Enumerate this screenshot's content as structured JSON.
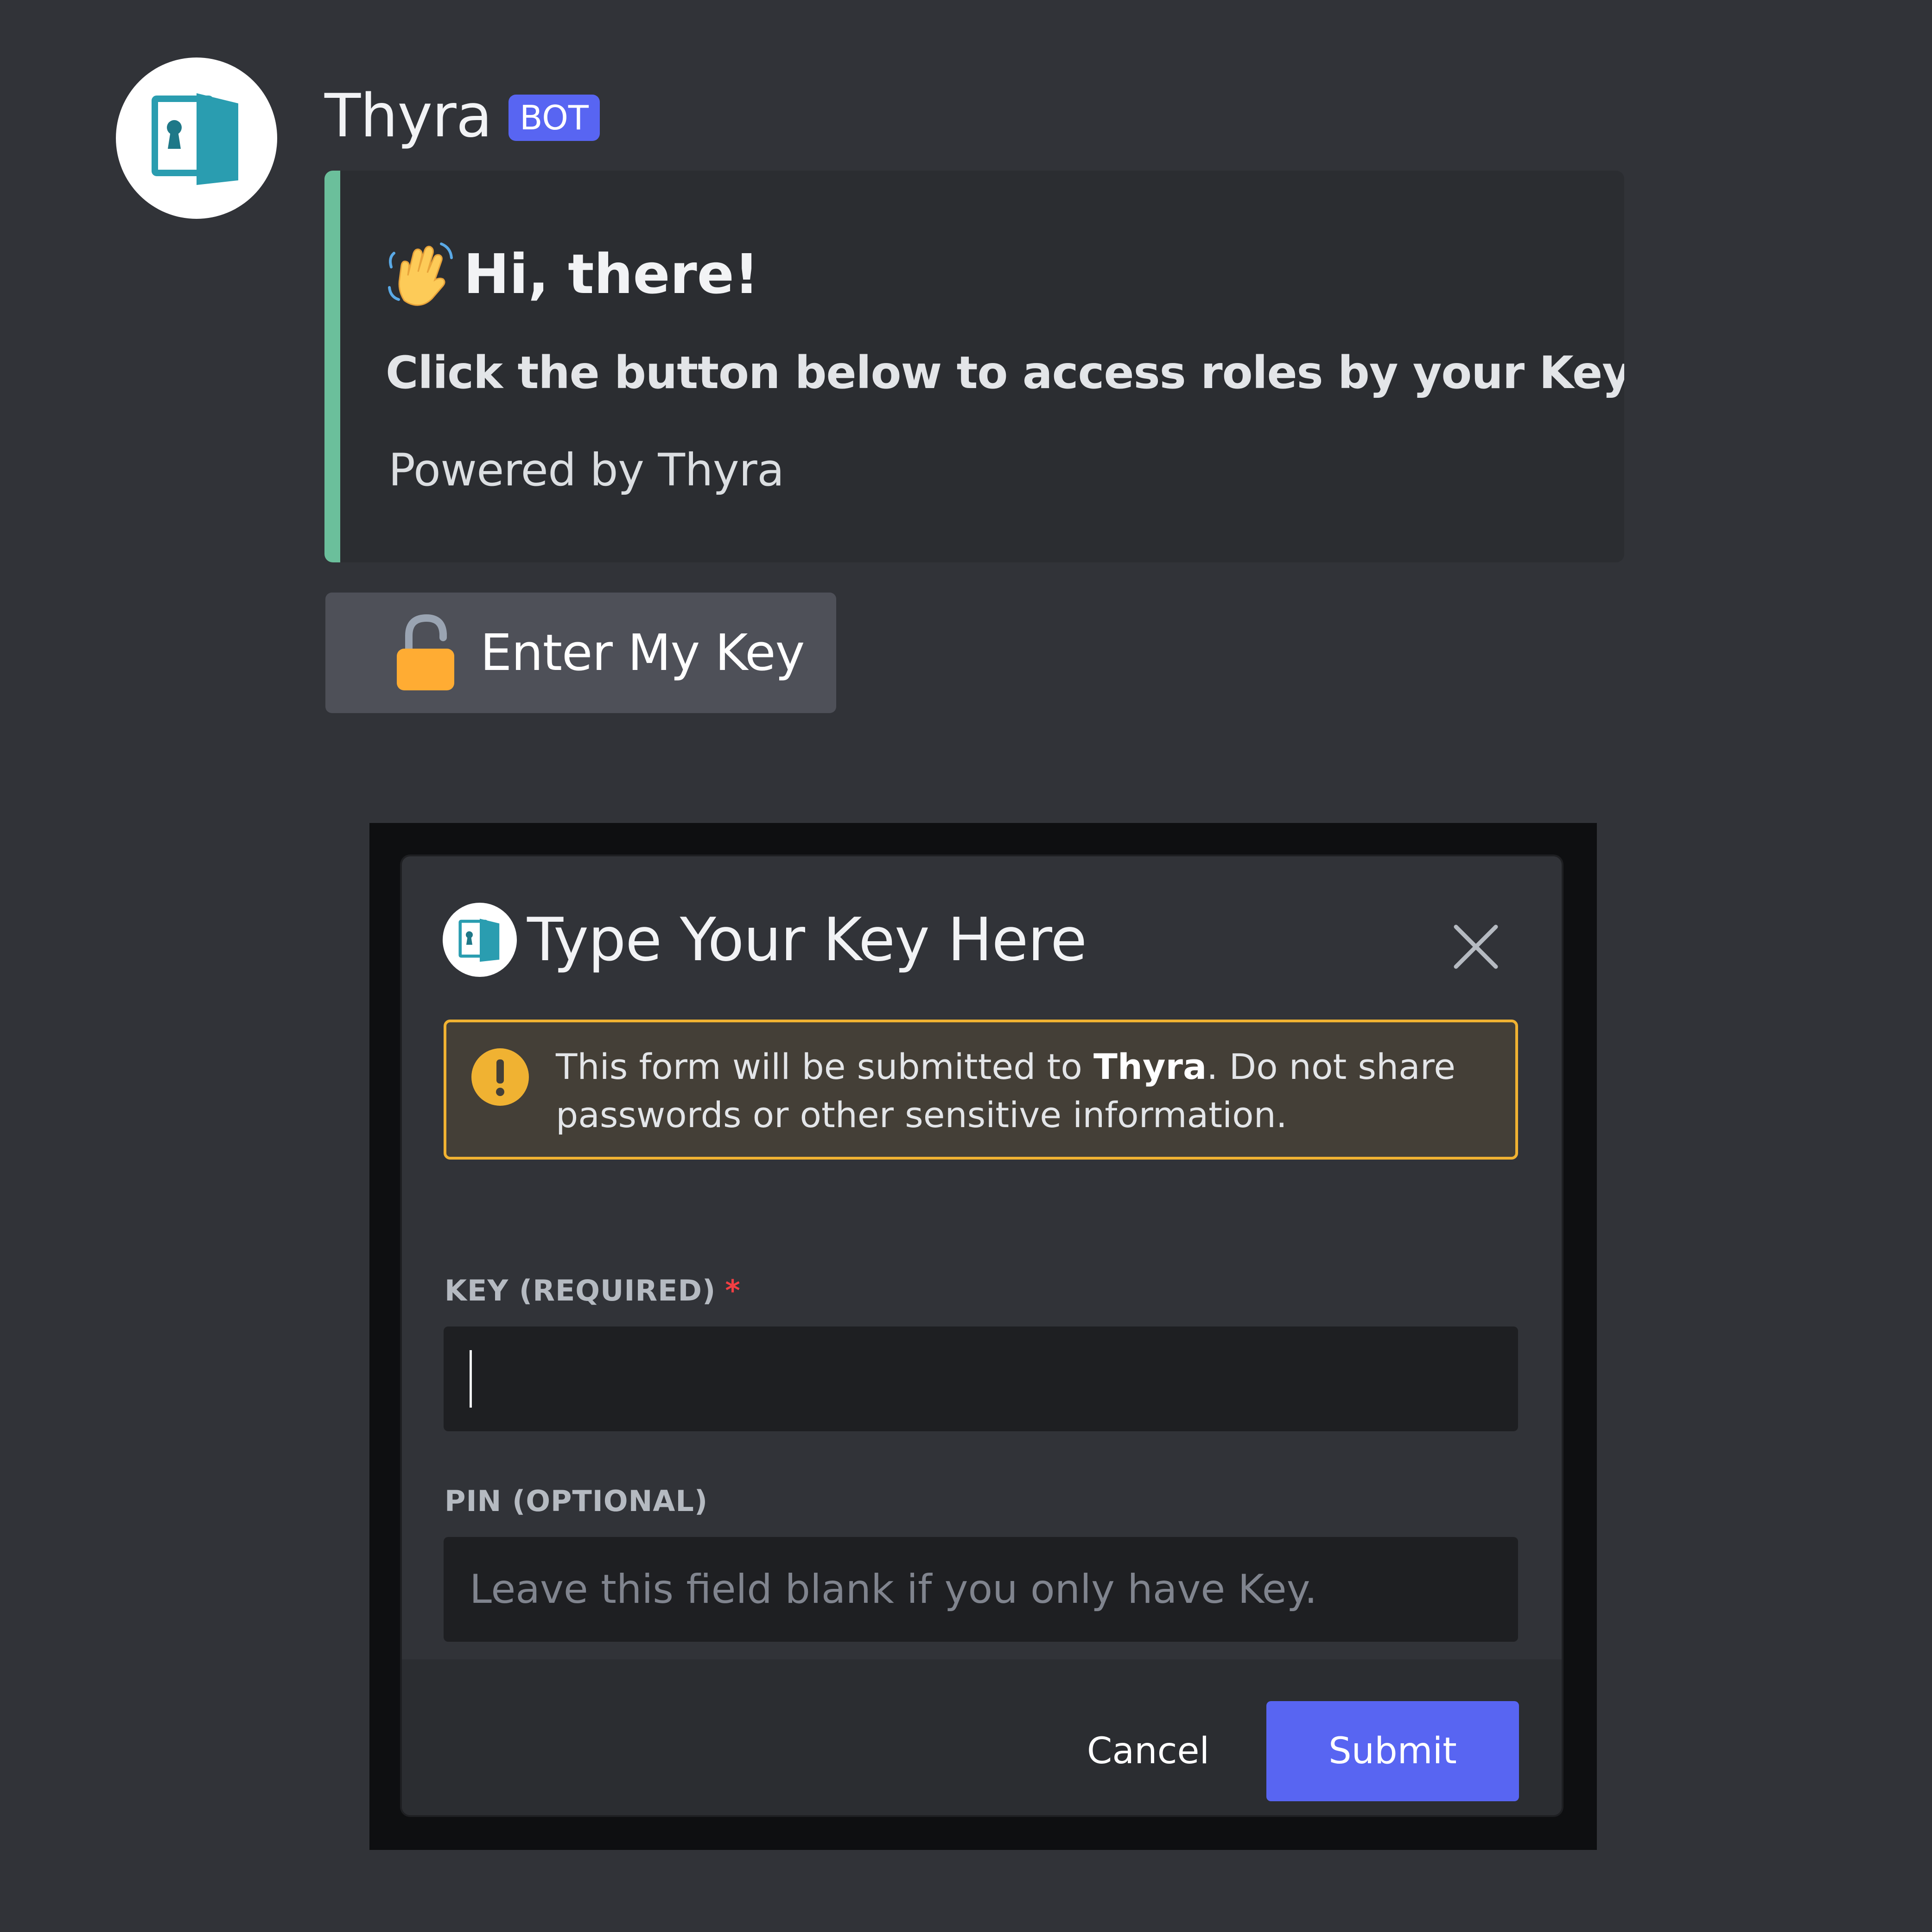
{
  "message": {
    "author": "Thyra",
    "bot_tag": "BOT",
    "avatar_icon": "door-keyhole-icon",
    "embed": {
      "accent_color": "#6bbf9b",
      "title_emoji": "waving-hand-icon",
      "title": "Hi, there!",
      "description": "Click the button below to access roles by your Key.",
      "footer": "Powered by Thyra"
    },
    "button": {
      "icon": "open-lock-icon",
      "label": "Enter My Key"
    }
  },
  "modal": {
    "title": "Type Your Key Here",
    "avatar_icon": "door-keyhole-icon",
    "close_icon": "close-icon",
    "warning": {
      "icon": "exclamation-icon",
      "prefix": "This form will be submitted to ",
      "app_name": "Thyra",
      "suffix": ". Do not share passwords or other sensitive information.",
      "border_color": "#f0b232"
    },
    "fields": {
      "key": {
        "label": "KEY (REQUIRED)",
        "required_mark": "*",
        "value": ""
      },
      "pin": {
        "label": "PIN (OPTIONAL)",
        "placeholder": "Leave this field blank if you only have Key.",
        "value": ""
      }
    },
    "buttons": {
      "cancel": "Cancel",
      "submit": "Submit"
    }
  },
  "colors": {
    "background": "#313338",
    "brand": "#5865f2",
    "warning": "#f0b232",
    "required": "#f23f43"
  }
}
